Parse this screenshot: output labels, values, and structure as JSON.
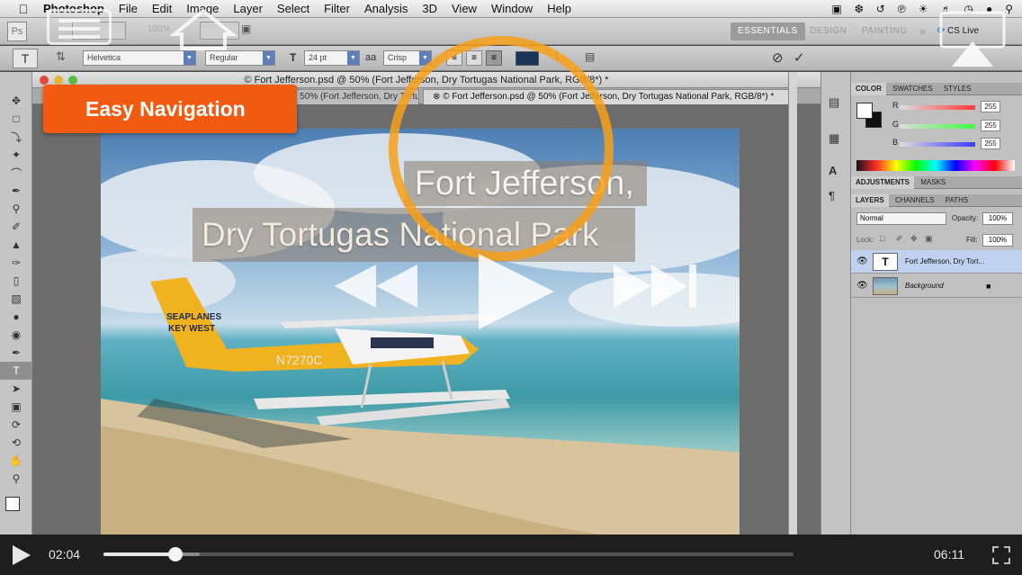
{
  "menubar": {
    "app_name": "Photoshop",
    "items": [
      "File",
      "Edit",
      "Image",
      "Layer",
      "Select",
      "Filter",
      "Analysis",
      "3D",
      "View",
      "Window",
      "Help"
    ]
  },
  "appbar": {
    "logo": "Ps",
    "zoom": "100%",
    "workspaces": [
      "ESSENTIALS",
      "DESIGN",
      "PAINTING"
    ],
    "more": "»",
    "cs_live": "CS Live"
  },
  "options_bar": {
    "tool_glyph": "T",
    "font_family": "Helvetica",
    "font_style": "Regular",
    "font_size": "24 pt",
    "aa_label": "aa",
    "antialias": "Crisp",
    "text_color": "#1b3558"
  },
  "document": {
    "window_title": "© Fort Jefferson.psd @ 50% (Fort Jefferson,  Dry Tortugas National Park, RGB/8*) *",
    "tabs": [
      {
        "label": "© Fort Jefferson.psd @ 50% (Fort Jefferson,  Dry Tortugas National Park, RGB/8*) *"
      },
      {
        "label": "© Fort Jefferson.psd @ 50% (Fort Jefferson,  Dry Tortugas National Park, RGB/8*) *"
      }
    ],
    "canvas_text_line1": "Fort Jefferson,",
    "canvas_text_line2": "Dry Tortugas National Park",
    "plane_text": "SEAPLANES\nKEY WEST",
    "plane_reg": "N7270C"
  },
  "panels": {
    "color_tabs": [
      "COLOR",
      "SWATCHES",
      "STYLES"
    ],
    "channels": [
      {
        "label": "R",
        "value": "255",
        "color": "#ff3a3a"
      },
      {
        "label": "G",
        "value": "255",
        "color": "#3aff3a"
      },
      {
        "label": "B",
        "value": "255",
        "color": "#3a3aff"
      }
    ],
    "adjust_tabs": [
      "ADJUSTMENTS",
      "MASKS"
    ],
    "layer_tabs": [
      "LAYERS",
      "CHANNELS",
      "PATHS"
    ],
    "blend_mode": "Normal",
    "opacity_label": "Opacity:",
    "opacity": "100%",
    "lock_label": "Lock:",
    "fill_label": "Fill:",
    "fill": "100%",
    "layers": [
      {
        "name": "Fort Jefferson,  Dry Tort...",
        "glyph": "T"
      },
      {
        "name": "Background",
        "glyph": ""
      }
    ]
  },
  "overlay": {
    "label": "Easy Navigation",
    "accent": "#f25a12"
  },
  "player": {
    "elapsed": "02:04",
    "total": "06:11",
    "progress": 0.104,
    "buffered": 0.14
  }
}
